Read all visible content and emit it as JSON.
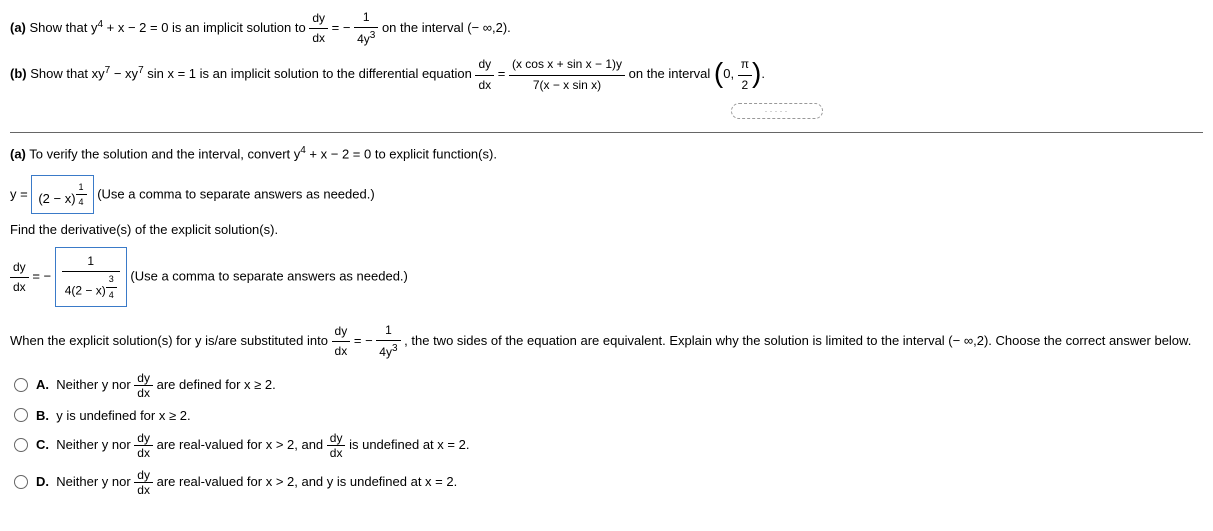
{
  "partA": {
    "label": "(a)",
    "text1": "Show that y",
    "exp1": "4",
    "text2": " + x − 2 = 0 is an implicit solution to ",
    "lhs_num": "dy",
    "lhs_den": "dx",
    "eq": " = − ",
    "rhs_num": "1",
    "rhs_den": "4y",
    "rhs_den_exp": "3",
    "text3": " on the interval (− ∞,2)."
  },
  "partB": {
    "label": "(b)",
    "text1": "Show that xy",
    "exp1": "7",
    "text2": " − xy",
    "exp2": "7",
    "text3": " sin x = 1 is an implicit solution to the differential equation ",
    "lhs_num": "dy",
    "lhs_den": "dx",
    "eq": " = ",
    "rhs_num": "(x cos x + sin x − 1)y",
    "rhs_den": "7(x − x sin x)",
    "text4": " on the interval ",
    "int_lo": "0, ",
    "int_hi_num": "π",
    "int_hi_den": "2",
    "text5": "."
  },
  "verify": {
    "label": "(a)",
    "text": " To verify the solution and the interval, convert y",
    "exp": "4",
    "text2": " + x − 2 = 0 to explicit function(s)."
  },
  "explicit": {
    "prefix": "y = ",
    "box_num": "1",
    "box_den": "4",
    "box_base": "(2 − x)",
    "hint": " (Use a comma to separate answers as needed.)"
  },
  "findDeriv": "Find the derivative(s) of the explicit solution(s).",
  "deriv": {
    "lhs_num": "dy",
    "lhs_den": "dx",
    "eq": " = − ",
    "box_num": "1",
    "box_den_base": "4(2 − x)",
    "box_den_num": "3",
    "box_den_den": "4",
    "hint": " (Use a comma to separate answers as needed.)"
  },
  "subst": {
    "text1": "When the explicit solution(s) for y is/are substituted into ",
    "lhs_num": "dy",
    "lhs_den": "dx",
    "eq": " = − ",
    "rhs_num": "1",
    "rhs_den": "4y",
    "rhs_den_exp": "3",
    "text2": ", the two sides of the equation are equivalent. Explain why the solution is limited to the interval (− ∞,2). Choose the correct answer below."
  },
  "options": {
    "A": {
      "letter": "A.",
      "t1": "Neither y nor ",
      "f_num": "dy",
      "f_den": "dx",
      "t2": " are defined for x ≥ 2."
    },
    "B": {
      "letter": "B.",
      "t1": "y is undefined for x ≥ 2."
    },
    "C": {
      "letter": "C.",
      "t1": "Neither y nor ",
      "f_num": "dy",
      "f_den": "dx",
      "t2": " are real-valued for x > 2, and ",
      "g_num": "dy",
      "g_den": "dx",
      "t3": " is undefined at x = 2."
    },
    "D": {
      "letter": "D.",
      "t1": "Neither y nor ",
      "f_num": "dy",
      "f_den": "dx",
      "t2": " are real-valued for x > 2, and y is undefined at x = 2."
    }
  }
}
